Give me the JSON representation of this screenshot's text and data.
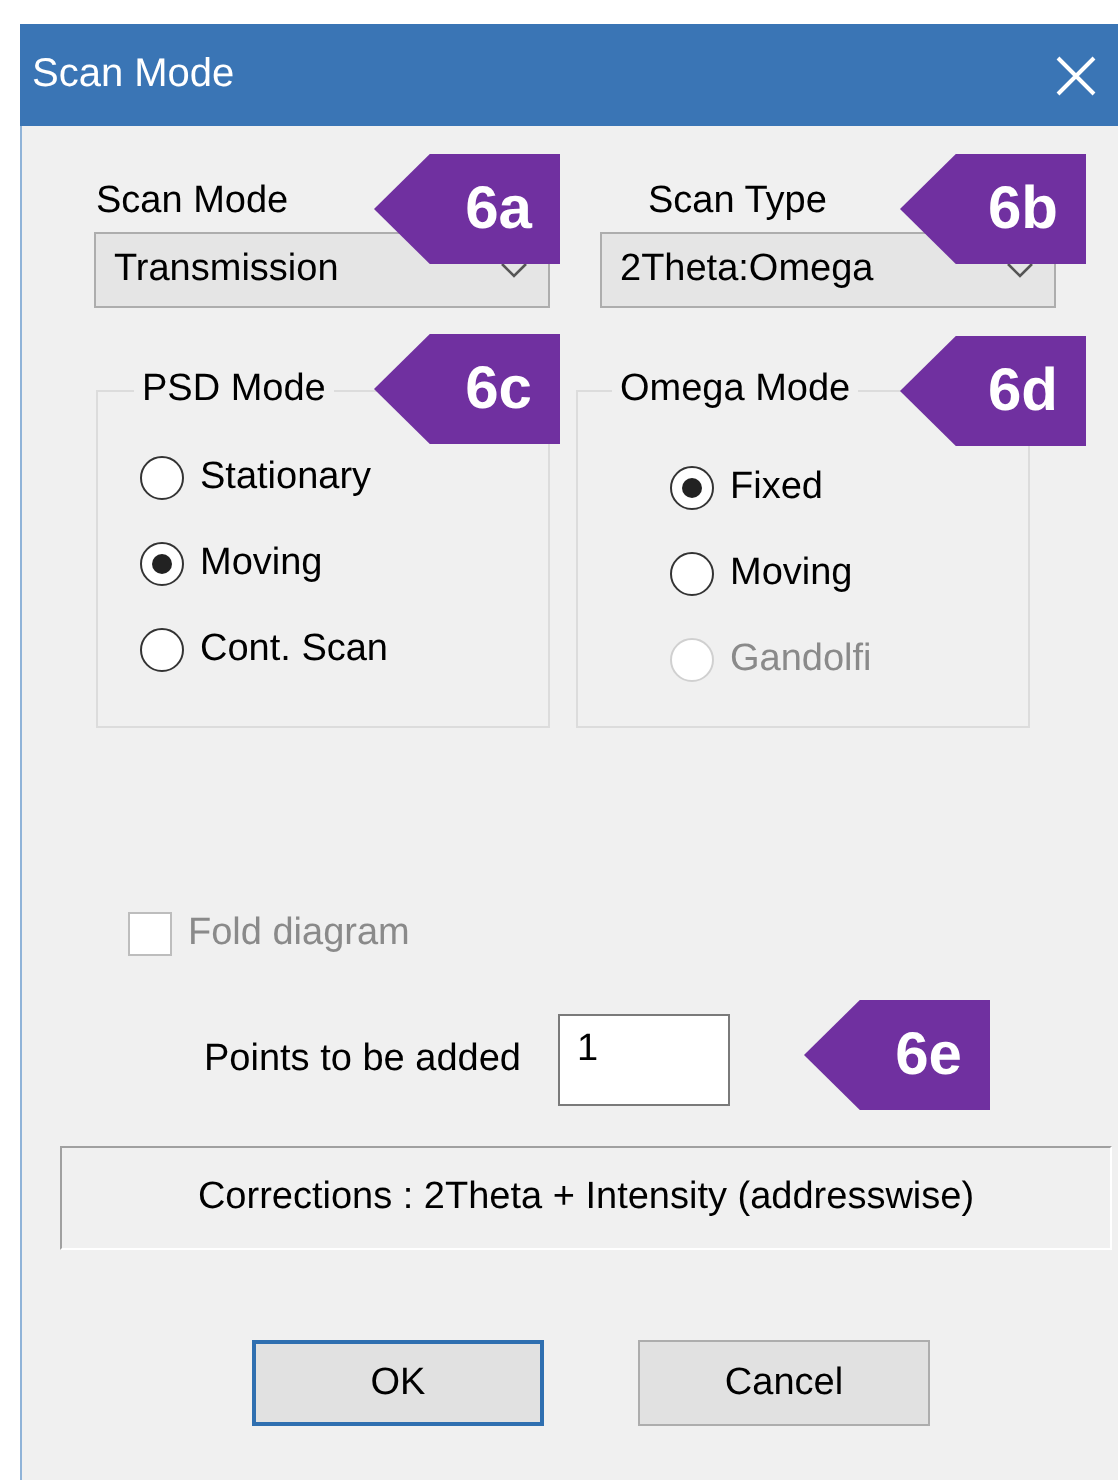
{
  "window": {
    "title": "Scan Mode"
  },
  "scan_mode": {
    "label": "Scan Mode",
    "value": "Transmission"
  },
  "scan_type": {
    "label": "Scan Type",
    "value": "2Theta:Omega"
  },
  "psd_mode": {
    "label": "PSD Mode",
    "options": [
      {
        "label": "Stationary",
        "selected": false,
        "disabled": false
      },
      {
        "label": "Moving",
        "selected": true,
        "disabled": false
      },
      {
        "label": "Cont. Scan",
        "selected": false,
        "disabled": false
      }
    ]
  },
  "omega_mode": {
    "label": "Omega Mode",
    "options": [
      {
        "label": "Fixed",
        "selected": true,
        "disabled": false
      },
      {
        "label": "Moving",
        "selected": false,
        "disabled": false
      },
      {
        "label": "Gandolfi",
        "selected": false,
        "disabled": true
      }
    ]
  },
  "fold_diagram": {
    "label": "Fold diagram",
    "checked": false,
    "disabled": true
  },
  "points": {
    "label": "Points to be added",
    "value": "1"
  },
  "corrections": "Corrections : 2Theta + Intensity (addresswise)",
  "buttons": [
    {
      "label": "OK",
      "default": true
    },
    {
      "label": "Cancel",
      "default": false
    }
  ],
  "callouts": [
    {
      "label": "6a"
    },
    {
      "label": "6b"
    },
    {
      "label": "6c"
    },
    {
      "label": "6d"
    },
    {
      "label": "6e"
    }
  ]
}
